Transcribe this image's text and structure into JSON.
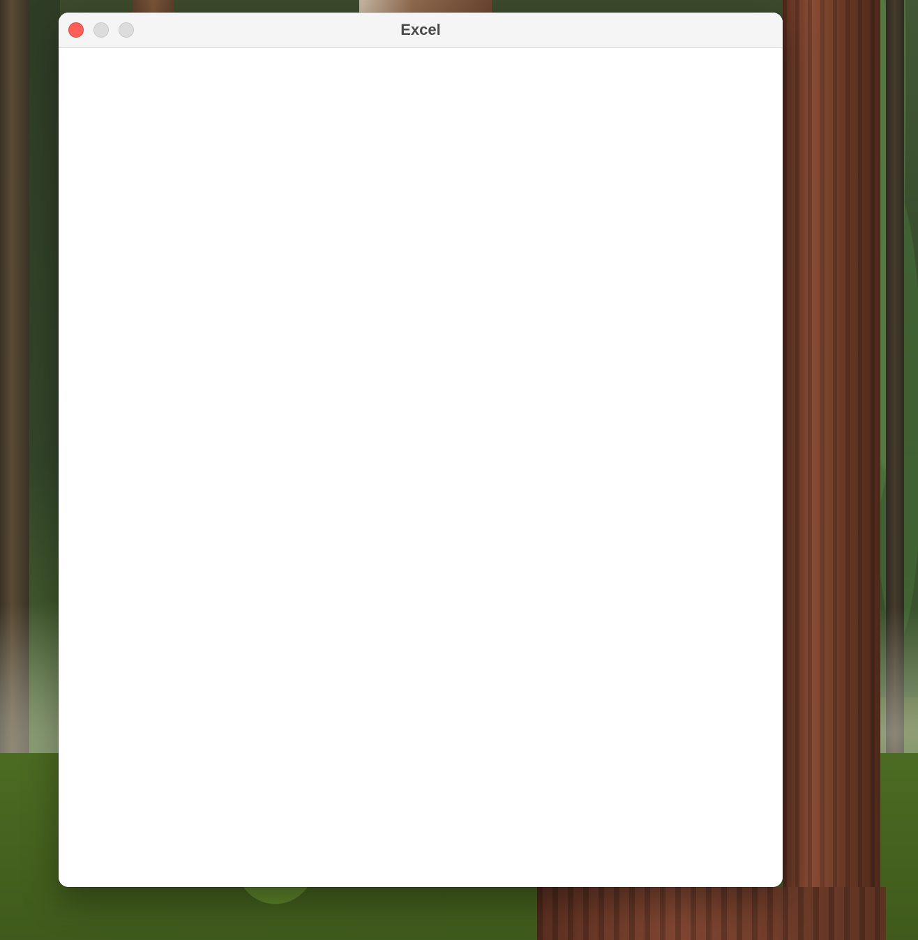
{
  "window": {
    "title": "Excel",
    "controls": {
      "close": "close-icon",
      "minimize": "minimize-icon",
      "zoom": "zoom-icon"
    },
    "colors": {
      "close": "#fe5f57",
      "inactive_control": "#dddcdd",
      "titlebar": "#f6f5f5",
      "content": "#ffffff"
    }
  }
}
